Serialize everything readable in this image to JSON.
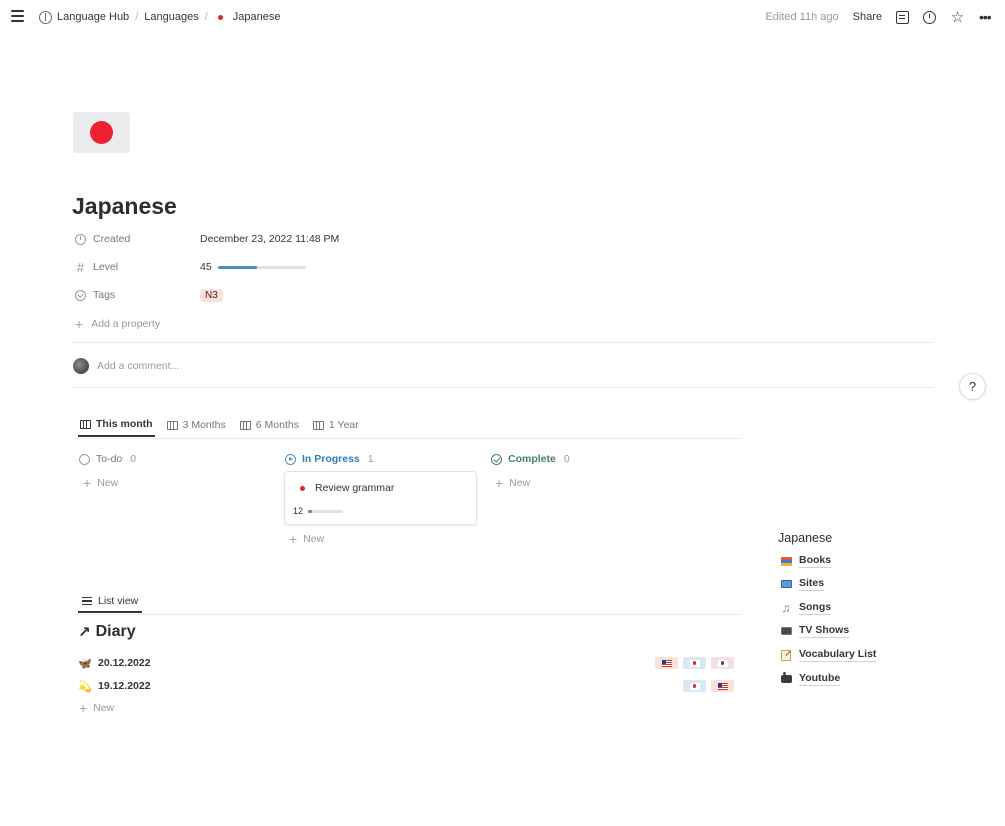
{
  "topbar": {
    "breadcrumbs": [
      "Language Hub",
      "Languages",
      "Japanese"
    ],
    "edited": "Edited 11h ago",
    "share": "Share"
  },
  "page": {
    "title": "Japanese",
    "properties": {
      "created_label": "Created",
      "created_value": "December 23, 2022 11:48 PM",
      "level_label": "Level",
      "level_value": "45",
      "level_progress": 0.45,
      "tags_label": "Tags",
      "tag": "N3",
      "add_property": "Add a property"
    },
    "comment_placeholder": "Add a comment..."
  },
  "board": {
    "tabs": [
      "This month",
      "3 Months",
      "6 Months",
      "1 Year"
    ],
    "columns": [
      {
        "label": "To-do",
        "count": "0",
        "color": "#787774"
      },
      {
        "label": "In Progress",
        "count": "1",
        "color": "#2f7fb5"
      },
      {
        "label": "Complete",
        "count": "0",
        "color": "#448361"
      }
    ],
    "card": {
      "title": "Review grammar",
      "value": "12",
      "progress": 0.12
    },
    "new_label": "New"
  },
  "list": {
    "tab": "List view",
    "heading": "Diary",
    "rows": [
      {
        "date": "20.12.2022",
        "emoji": "🦋",
        "flags": [
          "us",
          "jp",
          "kr"
        ]
      },
      {
        "date": "19.12.2022",
        "emoji": "💫",
        "flags": [
          "jp",
          "us"
        ]
      }
    ],
    "new_label": "New"
  },
  "sidebar": {
    "title": "Japanese",
    "links": [
      {
        "label": "Books",
        "icon": "books-icon"
      },
      {
        "label": "Sites",
        "icon": "computer-icon"
      },
      {
        "label": "Songs",
        "icon": "music-note-icon"
      },
      {
        "label": "TV Shows",
        "icon": "tv-icon"
      },
      {
        "label": "Vocabulary List",
        "icon": "memo-icon"
      },
      {
        "label": "Youtube",
        "icon": "camera-icon"
      }
    ]
  },
  "help": "?",
  "colors": {
    "accent_blue": "#4a8ec2",
    "flag_red": "#ec2233",
    "tag_bg": "#fbe1dc"
  }
}
